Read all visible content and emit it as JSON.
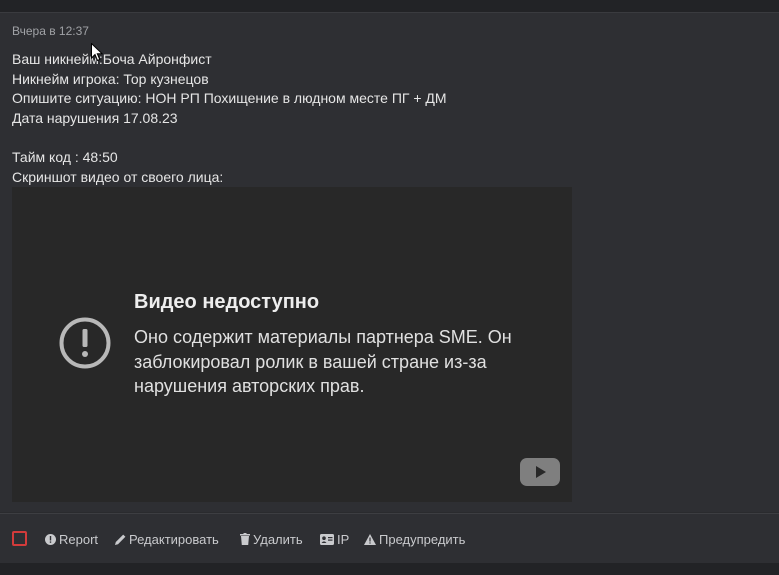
{
  "post": {
    "timestamp": "Вчера в 12:37",
    "lines": [
      "Ваш никнейм:Боча Айронфист",
      "Никнейм игрока: Тор кузнецов",
      "Опишите ситуацию: НОН РП Похищение в людном месте ПГ + ДМ",
      "Дата нарушения 17.08.23",
      "",
      "Тайм код : 48:50",
      "Скриншот видео от своего лица:"
    ]
  },
  "video": {
    "title": "Видео недоступно",
    "message": "Оно содержит материалы партнера SME. Он заблокировал ролик в вашей стране из-за нарушения авторских прав.",
    "icon": "alert-circle-icon",
    "logo_icon": "youtube-logo-icon"
  },
  "actions": {
    "report": "Report",
    "edit": "Редактировать",
    "delete": "Удалить",
    "ip": "IP",
    "warn": "Предупредить"
  },
  "colors": {
    "background": "#2e2f33",
    "video_background": "#282828",
    "select_box_border": "#d23b3b",
    "action_text": "#c9cacd"
  }
}
